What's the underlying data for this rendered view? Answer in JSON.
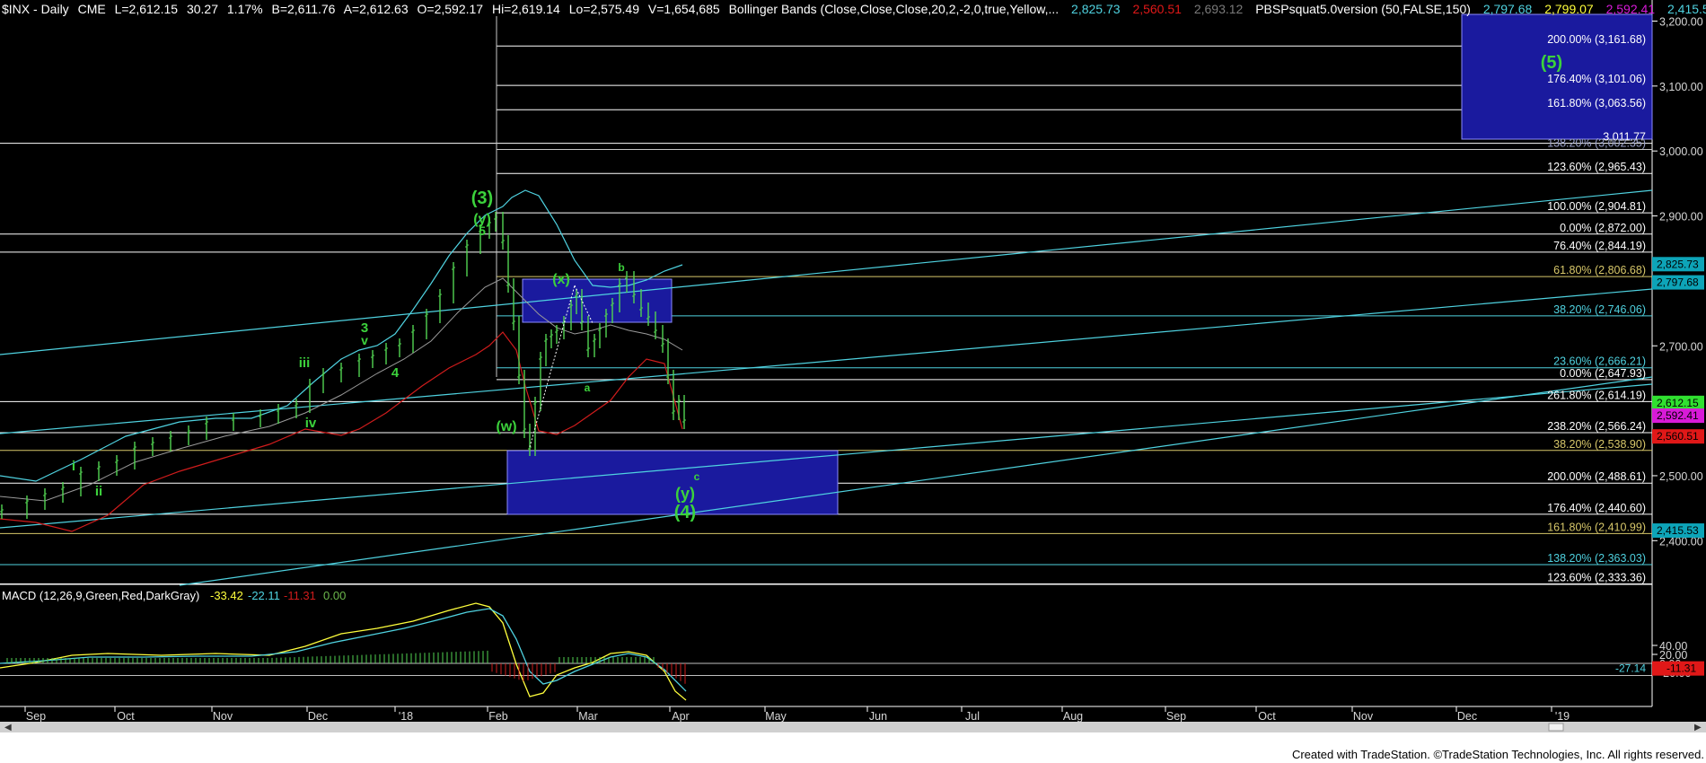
{
  "header": {
    "symbol": "$INX - Daily",
    "exchange": "CME",
    "last": "L=2,612.15",
    "change": "30.27",
    "change_pct": "1.17%",
    "bid": "B=2,611.76",
    "ask": "A=2,612.63",
    "open": "O=2,592.17",
    "high": "Hi=2,619.14",
    "low": "Lo=2,575.49",
    "volume": "V=1,654,685",
    "bb_label": "Bollinger Bands (Close,Close,Close,20,2,-2,0,true,Yellow,...",
    "bb_upper": "2,825.73",
    "bb_lower": "2,560.51",
    "bb_mid": "2,693.12",
    "pbs_label": "PBSPsquat5.0version (50,FALSE,150)",
    "pbs_v1": "2,797.68",
    "pbs_v2": "2,799.07",
    "pbs_v3": "2,592.41",
    "pbs_v4": "2,415.53"
  },
  "colors": {
    "background": "#000000",
    "grid_line": "#c8c8c8",
    "trend_line": "#4fd2e0",
    "box_fill": "#1a1a9e",
    "wave_label": "#3cd23c",
    "up_bar": "#52d452",
    "bb_upper": "#4fd2e0",
    "bb_lower": "#d01c1c",
    "bb_mid": "#9a9a9a",
    "macd_line": "#ffff3c",
    "macd_signal": "#4fd2e0",
    "macd_hist_pos": "#52d452",
    "macd_hist_neg": "#d01c1c",
    "price_tag_green": "#30e030",
    "price_tag_red": "#e01818",
    "price_tag_magenta": "#d81ad8",
    "price_tag_cyan": "#0da4b8"
  },
  "price_axis": {
    "ticks": [
      "3,200.00",
      "3,100.00",
      "3,000.00",
      "2,900.00",
      "2,800.00",
      "2,700.00",
      "2,600.00",
      "2,500.00",
      "2,400.00"
    ],
    "tags": [
      {
        "label": "2,825.73",
        "color": "cyan"
      },
      {
        "label": "2,797.68",
        "color": "cyan"
      },
      {
        "label": "2,612.15",
        "color": "green"
      },
      {
        "label": "2,592.41",
        "color": "magenta"
      },
      {
        "label": "2,560.51",
        "color": "red"
      },
      {
        "label": "2,415.53",
        "color": "cyan"
      }
    ]
  },
  "fib_levels": [
    {
      "label": "200.00% (3,161.68)",
      "color": "#ffffff"
    },
    {
      "label": "176.40% (3,101.06)",
      "color": "#ffffff"
    },
    {
      "label": "161.80% (3,063.56)",
      "color": "#ffffff"
    },
    {
      "label": "3,011.77",
      "color": "#ffffff"
    },
    {
      "label": "138.20% (3,002.35)",
      "color": "#9aa0c8"
    },
    {
      "label": "123.60% (2,965.43)",
      "color": "#ffffff"
    },
    {
      "label": "100.00% (2,904.81)",
      "color": "#ffffff"
    },
    {
      "label": "0.00% (2,872.00)",
      "color": "#ffffff"
    },
    {
      "label": "76.40% (2,844.19)",
      "color": "#ffffff"
    },
    {
      "label": "61.80% (2,806.68)",
      "color": "#d8c86a"
    },
    {
      "label": "38.20% (2,746.06)",
      "color": "#4fd2e0"
    },
    {
      "label": "23.60% (2,666.21)",
      "color": "#4fd2e0"
    },
    {
      "label": "0.00% (2,647.93)",
      "color": "#ffffff"
    },
    {
      "label": "261.80% (2,614.19)",
      "color": "#ffffff"
    },
    {
      "label": "238.20% (2,566.24)",
      "color": "#ffffff"
    },
    {
      "label": "38.20% (2,538.90)",
      "color": "#d8c86a"
    },
    {
      "label": "200.00% (2,488.61)",
      "color": "#ffffff"
    },
    {
      "label": "176.40% (2,440.60)",
      "color": "#ffffff"
    },
    {
      "label": "161.80% (2,410.99)",
      "color": "#d8c86a"
    },
    {
      "label": "138.20% (2,363.03)",
      "color": "#4fd2e0"
    },
    {
      "label": "123.60% (2,333.36)",
      "color": "#ffffff"
    }
  ],
  "wave_labels": [
    "(3)",
    "(y)",
    "5",
    "(x)",
    "b",
    "a",
    "(w)",
    "3",
    "v",
    "4",
    "iii",
    "iv",
    "i",
    "ii",
    "c",
    "(y)",
    "(4)",
    "(5)"
  ],
  "macd": {
    "label": "MACD (12,26,9,Green,Red,DarkGray)",
    "value1": "-33.42",
    "value2": "-22.11",
    "value3": "-11.31",
    "value4": "0.00",
    "ticks": [
      "40.00",
      "20.00",
      "0.00",
      "-20.00"
    ],
    "tag_value": "-11.31",
    "last_label": "-27.14"
  },
  "time_axis": {
    "months": [
      "Sep",
      "Oct",
      "Nov",
      "Dec",
      "'18",
      "Feb",
      "Mar",
      "Apr",
      "May",
      "Jun",
      "Jul",
      "Aug",
      "Sep",
      "Oct",
      "Nov",
      "Dec",
      "'19"
    ]
  },
  "footer": {
    "credits": "Created with TradeStation. ©TradeStation Technologies, Inc. All rights reserved."
  }
}
